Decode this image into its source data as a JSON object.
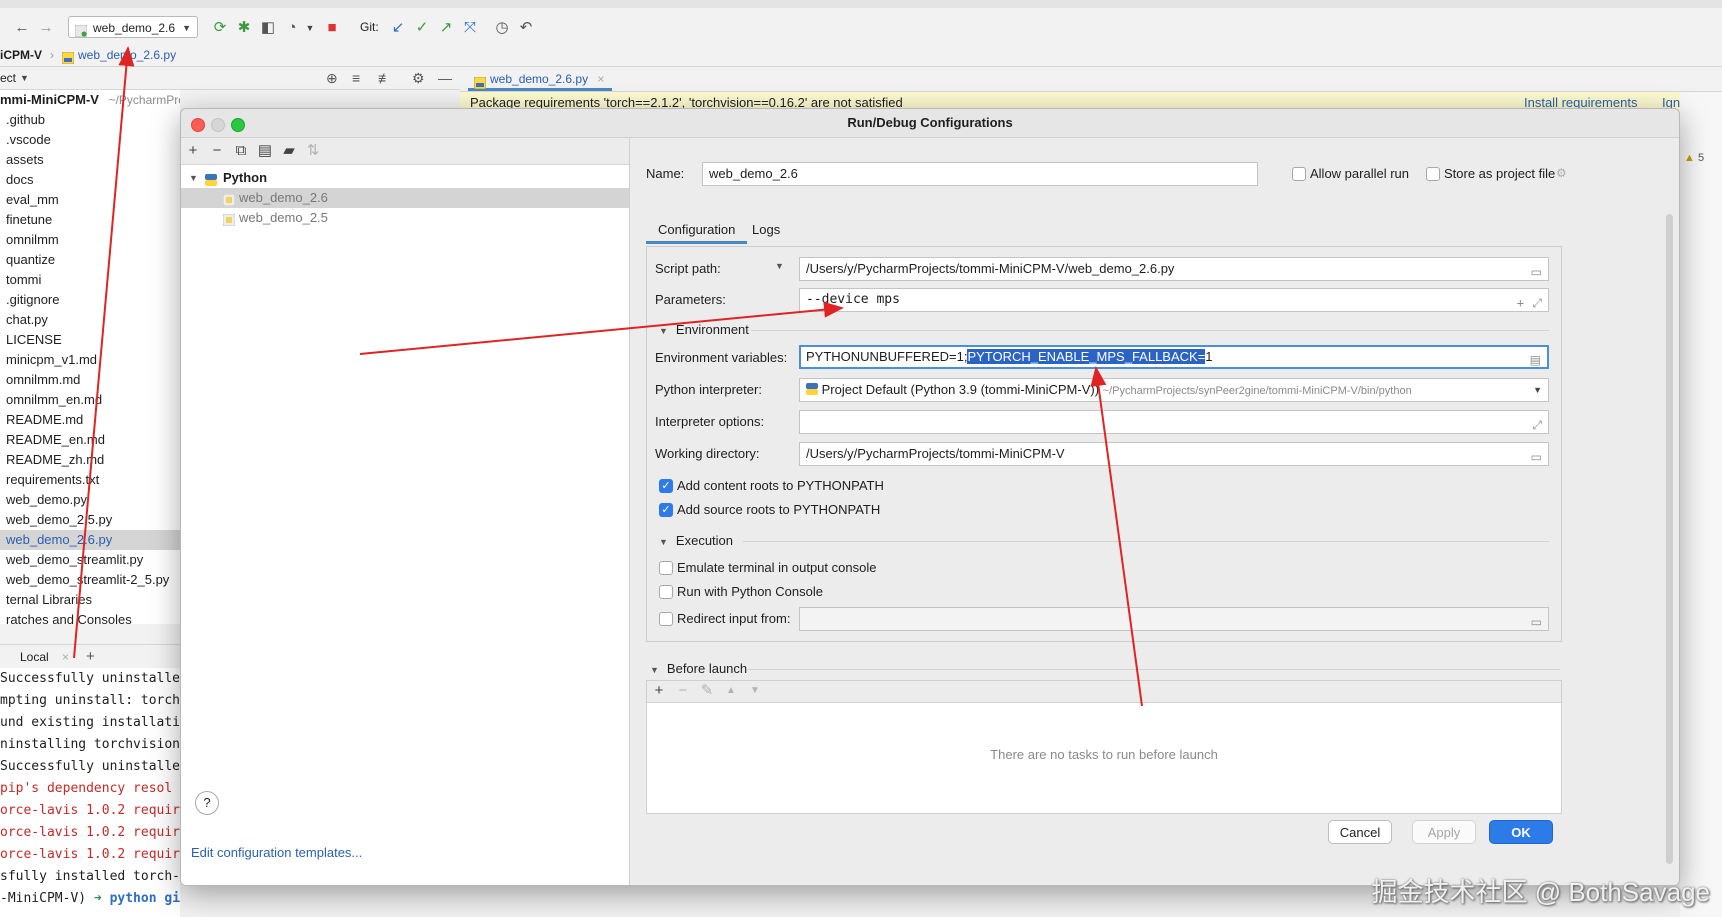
{
  "ide": {
    "run_config": "web_demo_2.6",
    "git_label": "Git:",
    "breadcrumb_project": "iCPM-V",
    "breadcrumb_file": "web_demo_2.6.py",
    "panel_label": "ect",
    "editor_tab": "web_demo_2.6.py",
    "banner_text": "Package requirements 'torch==2.1.2', 'torchvision==0.16.2' are not satisfied",
    "banner_install": "Install requirements",
    "banner_ignore": "Ignore re",
    "warnings_count": "5",
    "tree_root": "mmi-MiniCPM-V",
    "tree_root_path": "~/PycharmProjects/tommi-MiniCPM-V",
    "tree_items": [
      ".github",
      ".vscode",
      "assets",
      "docs",
      "eval_mm",
      "finetune",
      "omnilmm",
      "quantize",
      "tommi",
      ".gitignore",
      "chat.py",
      "LICENSE",
      "minicpm_v1.md",
      "omnilmm.md",
      "omnilmm_en.md",
      "README.md",
      "README_en.md",
      "README_zh.md",
      "requirements.txt",
      "web_demo.py",
      "web_demo_2.5.py",
      "web_demo_2.6.py",
      "web_demo_streamlit.py",
      "web_demo_streamlit-2_5.py",
      "ternal Libraries",
      "ratches and Consoles"
    ],
    "terminal_tab": "Local",
    "terminal_lines": [
      {
        "text": "Successfully uninstalle",
        "red": false
      },
      {
        "text": "mpting uninstall: torch",
        "red": false
      },
      {
        "text": "und existing installati",
        "red": false
      },
      {
        "text": "ninstalling torchvision-",
        "red": false
      },
      {
        "text": "Successfully uninstalle",
        "red": false
      },
      {
        "text": " pip's dependency resol",
        "red": true
      },
      {
        "text": "orce-lavis 1.0.2 requir",
        "red": true
      },
      {
        "text": "orce-lavis 1.0.2 requir",
        "red": true
      },
      {
        "text": "orce-lavis 1.0.2 requir",
        "red": true
      },
      {
        "text": "sfully installed torch-",
        "red": false
      }
    ],
    "prompt_dir": "-MiniCPM-V)",
    "prompt_cmd": "python",
    "prompt_git": "git:(master)",
    "prompt_x": "✗"
  },
  "dialog": {
    "title": "Run/Debug Configurations",
    "group": "Python",
    "configs": [
      "web_demo_2.6",
      "web_demo_2.5"
    ],
    "edit_templates": "Edit configuration templates...",
    "name_label": "Name:",
    "name_value": "web_demo_2.6",
    "allow_parallel": "Allow parallel run",
    "store_project": "Store as project file",
    "tabs": [
      "Configuration",
      "Logs"
    ],
    "script_path_label": "Script path:",
    "script_path_value": "/Users/y/PycharmProjects/tommi-MiniCPM-V/web_demo_2.6.py",
    "parameters_label": "Parameters:",
    "parameters_value": "--device mps",
    "environment_section": "Environment",
    "env_vars_label": "Environment variables:",
    "env_vars_prefix": "PYTHONUNBUFFERED=1;",
    "env_vars_selected": "PYTORCH_ENABLE_MPS_FALLBACK=",
    "env_vars_suffix": "1",
    "interpreter_label": "Python interpreter:",
    "interpreter_value": "Project Default (Python 3.9 (tommi-MiniCPM-V))",
    "interpreter_path": "~/PycharmProjects/synPeer2gine/tommi-MiniCPM-V/bin/python",
    "interp_options_label": "Interpreter options:",
    "working_dir_label": "Working directory:",
    "working_dir_value": "/Users/y/PycharmProjects/tommi-MiniCPM-V",
    "add_content_roots": "Add content roots to PYTHONPATH",
    "add_source_roots": "Add source roots to PYTHONPATH",
    "execution_section": "Execution",
    "emulate_terminal": "Emulate terminal in output console",
    "run_python_console": "Run with Python Console",
    "redirect_input": "Redirect input from:",
    "before_launch_section": "Before launch",
    "no_tasks": "There are no tasks to run before launch",
    "cancel": "Cancel",
    "apply": "Apply",
    "ok": "OK",
    "help": "?"
  },
  "watermark": "掘金技术社区 @ BothSavage",
  "colors": {
    "accent": "#2d7be8",
    "annotation_arrow": "#e02424",
    "warning_banner": "#fcf9cf"
  }
}
